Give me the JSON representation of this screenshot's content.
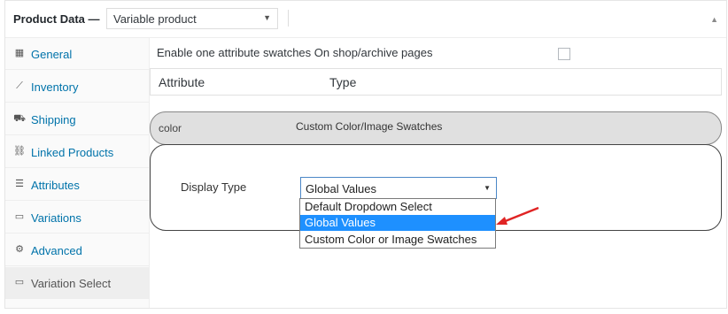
{
  "header": {
    "title": "Product Data —",
    "product_type": "Variable product",
    "accent": "#0073aa"
  },
  "tabs": [
    {
      "label": "General",
      "icon": "settings-grid-icon"
    },
    {
      "label": "Inventory",
      "icon": "chart-line-icon"
    },
    {
      "label": "Shipping",
      "icon": "truck-icon"
    },
    {
      "label": "Linked Products",
      "icon": "link-icon"
    },
    {
      "label": "Attributes",
      "icon": "list-icon"
    },
    {
      "label": "Variations",
      "icon": "window-icon"
    },
    {
      "label": "Advanced",
      "icon": "gear-icon"
    },
    {
      "label": "Variation Select",
      "icon": "window-icon"
    }
  ],
  "content": {
    "enable_label": "Enable one attribute swatches On shop/archive pages",
    "table_headers": [
      "Attribute",
      "Type"
    ],
    "attribute": {
      "name": "color",
      "type": "Custom Color/Image Swatches"
    },
    "display_type_label": "Display Type",
    "display_type_value": "Global Values",
    "display_type_options": [
      "Default Dropdown Select",
      "Global Values",
      "Custom Color or Image Swatches"
    ]
  }
}
